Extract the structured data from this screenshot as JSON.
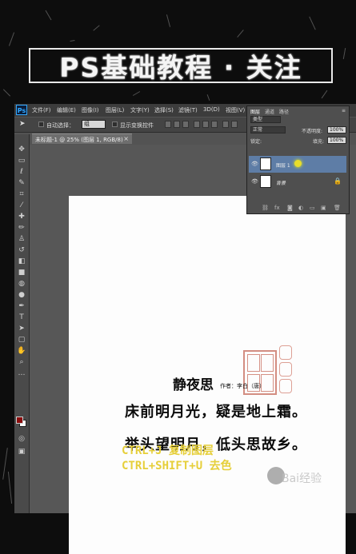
{
  "banner": {
    "title": "PS基础教程 · 关注"
  },
  "app": {
    "logo": "Ps",
    "menu": [
      "文件(F)",
      "编辑(E)",
      "图像(I)",
      "图层(L)",
      "文字(Y)",
      "选择(S)",
      "滤镜(T)",
      "3D(D)",
      "视图(V)"
    ],
    "options_bar": {
      "auto_select_label": "自动选择：",
      "auto_select_value": "组",
      "show_transform_label": "显示变换控件"
    },
    "document_tab": {
      "label": "未标题-1 @ 25% (图层 1, RGB/8)",
      "close": "×"
    }
  },
  "layers_panel": {
    "tabs": [
      "图层",
      "通道",
      "路径"
    ],
    "filter_label": "类型",
    "blend_mode": "正常",
    "opacity_label": "不透明度:",
    "opacity_value": "100%",
    "lock_label": "锁定:",
    "fill_label": "填充:",
    "fill_value": "100%",
    "layers": [
      {
        "name": "图层 1",
        "selected": true
      },
      {
        "name": "背景",
        "selected": false
      }
    ],
    "footer_icons": [
      "link-icon",
      "fx-icon",
      "mask-icon",
      "adjustment-icon",
      "folder-icon",
      "new-layer-icon",
      "trash-icon"
    ]
  },
  "canvas": {
    "poem_title": "静夜思",
    "poem_author": "作者：李白（唐）",
    "poem_line_1": "床前明月光，疑是地上霜。",
    "poem_line_2": "举头望明月，低头思故乡。"
  },
  "hints": {
    "line_1": "CTRL+J 复制图层",
    "line_2": "CTRL+SHIFT+U 去色"
  },
  "watermark": "Bai经验",
  "colors": {
    "foreground": "#8a0c0c",
    "background": "#ffffff",
    "hint_text": "#e6cf3a",
    "seal": "#c56a5a"
  }
}
